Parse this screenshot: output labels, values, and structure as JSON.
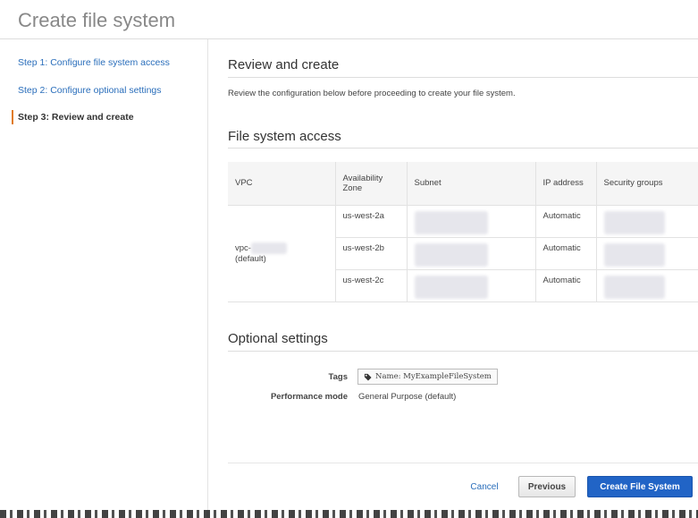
{
  "header": {
    "title": "Create file system"
  },
  "sidebar": {
    "steps": [
      {
        "label": "Step 1: Configure file system access"
      },
      {
        "label": "Step 2: Configure optional settings"
      },
      {
        "label": "Step 3: Review and create"
      }
    ]
  },
  "main": {
    "title": "Review and create",
    "description": "Review the configuration below before proceeding to create your file system.",
    "fs_access": {
      "title": "File system access",
      "headers": [
        "VPC",
        "Availability Zone",
        "Subnet",
        "IP address",
        "Security groups"
      ],
      "vpc": {
        "prefix": "vpc-",
        "suffix": "(default)"
      },
      "rows": [
        {
          "az": "us-west-2a",
          "ip": "Automatic"
        },
        {
          "az": "us-west-2b",
          "ip": "Automatic"
        },
        {
          "az": "us-west-2c",
          "ip": "Automatic"
        }
      ]
    },
    "optional": {
      "title": "Optional settings",
      "tags_label": "Tags",
      "tag_value": "Name: MyExampleFileSystem",
      "perf_label": "Performance mode",
      "perf_value": "General Purpose (default)"
    }
  },
  "footer": {
    "cancel": "Cancel",
    "previous": "Previous",
    "create": "Create File System"
  },
  "icons": {
    "tag": "tag-icon"
  },
  "colors": {
    "link": "#2a6ebb",
    "primary": "#2164c6",
    "active_marker": "#e07b1f"
  }
}
